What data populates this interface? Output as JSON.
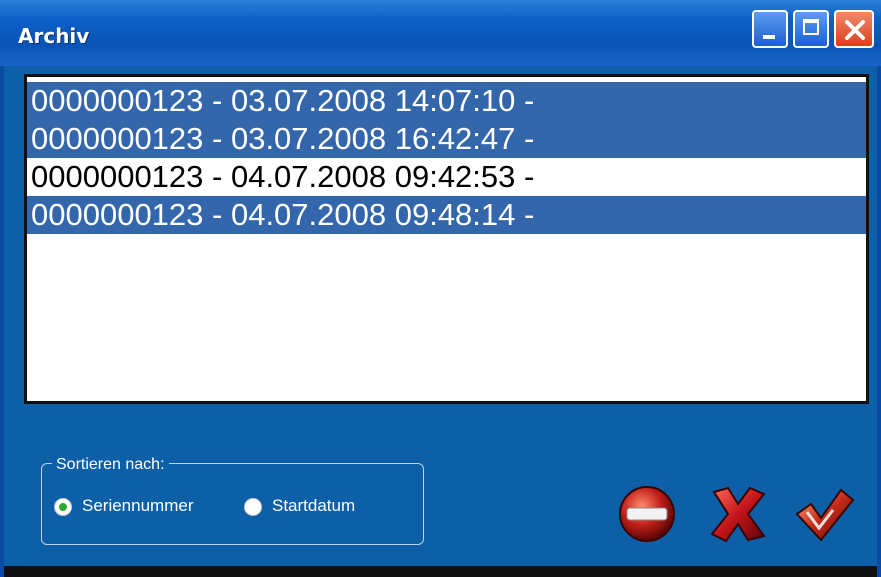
{
  "window": {
    "title": "Archiv"
  },
  "list": {
    "items": [
      {
        "label": "0000000123 - 03.07.2008 14:07:10 -",
        "selected": true
      },
      {
        "label": "0000000123 - 03.07.2008 16:42:47 -",
        "selected": true
      },
      {
        "label": "0000000123 - 04.07.2008 09:42:53 -",
        "selected": false
      },
      {
        "label": "0000000123 - 04.07.2008 09:48:14 -",
        "selected": true
      }
    ]
  },
  "sort": {
    "legend": "Sortieren nach:",
    "options": [
      {
        "label": "Seriennummer",
        "checked": true
      },
      {
        "label": "Startdatum",
        "checked": false
      }
    ]
  },
  "actions": {
    "icons": [
      "no-entry-icon",
      "red-x-icon",
      "checkmark-icon"
    ]
  },
  "colors": {
    "background": "#0d60a8",
    "selection": "#3366aa",
    "titlebar": "#0b5fc7"
  }
}
